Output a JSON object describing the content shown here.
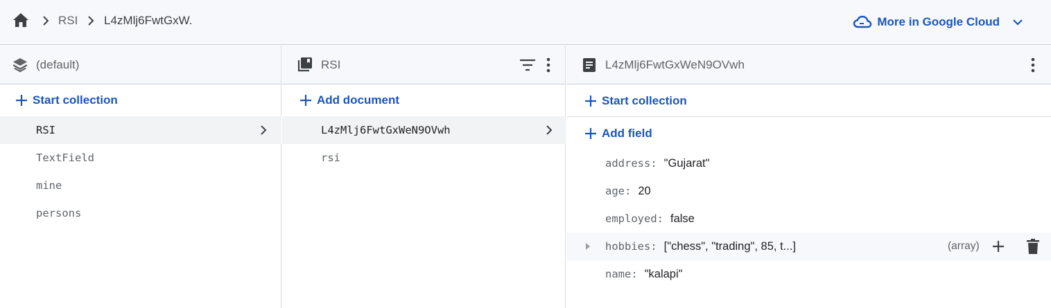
{
  "header": {
    "home_icon": "home-icon",
    "breadcrumbs": [
      "RSI",
      "L4zMlj6FwtGxW."
    ],
    "google_cloud_label": "More in Google Cloud"
  },
  "panel_root": {
    "title": "(default)",
    "action_label": "Start collection",
    "collections": [
      "RSI",
      "TextField",
      "mine",
      "persons"
    ]
  },
  "panel_collection": {
    "title": "RSI",
    "action_label": "Add document",
    "documents": [
      "L4zMlj6FwtGxWeN9OVwh",
      "rsi"
    ]
  },
  "panel_document": {
    "title": "L4zMlj6FwtGxWeN9OVwh",
    "start_collection_label": "Start collection",
    "add_field_label": "Add field",
    "fields": [
      {
        "key": "address:",
        "value": "\"Gujarat\""
      },
      {
        "key": "age:",
        "value": "20"
      },
      {
        "key": "employed:",
        "value": "false"
      },
      {
        "key": "hobbies:",
        "value": "[\"chess\", \"trading\", 85, t...]",
        "type": "(array)"
      },
      {
        "key": "name:",
        "value": "\"kalapi\""
      }
    ]
  },
  "colors": {
    "accent": "#1a56b8",
    "header_bg": "#f6f8fc",
    "selected_row": "#f1f3f4"
  }
}
